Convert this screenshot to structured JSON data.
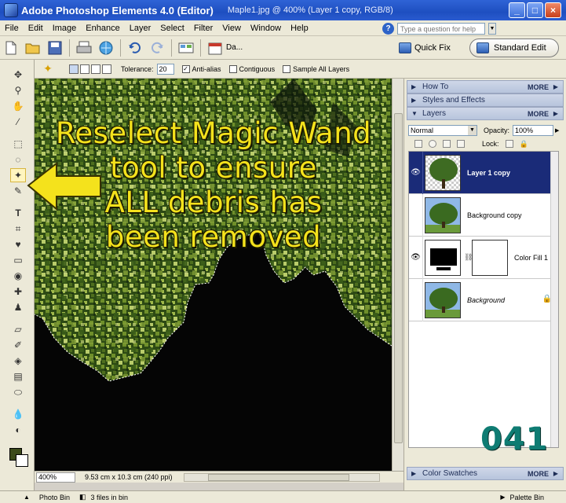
{
  "app": {
    "title": "Adobe Photoshop Elements 4.0 (Editor)",
    "document": "Maple1.jpg @ 400% (Layer 1 copy, RGB/8)"
  },
  "window_buttons": {
    "minimize": "_",
    "maximize": "□",
    "close": "×"
  },
  "menu": [
    "File",
    "Edit",
    "Image",
    "Enhance",
    "Layer",
    "Select",
    "Filter",
    "View",
    "Window",
    "Help"
  ],
  "help": {
    "placeholder": "Type a question for help"
  },
  "toolbar": {
    "icons": [
      "new-icon",
      "open-icon",
      "save-icon",
      "print-icon",
      "online-services-icon",
      "undo-icon",
      "redo-icon",
      "organizer-icon",
      "date-view-icon"
    ],
    "date_view_label": "Da...",
    "quick_fix_label": "Quick Fix",
    "standard_edit_label": "Standard Edit"
  },
  "options": {
    "tolerance_label": "Tolerance:",
    "tolerance_value": "20",
    "anti_alias_label": "Anti-alias",
    "anti_alias_checked": true,
    "contiguous_label": "Contiguous",
    "contiguous_checked": false,
    "sample_all_label": "Sample All Layers",
    "sample_all_checked": false
  },
  "tools": [
    "move-tool",
    "zoom-tool",
    "hand-tool",
    "eyedropper-tool",
    "marquee-tool",
    "lasso-tool",
    "magic-wand-tool",
    "selection-brush-tool",
    "type-tool",
    "crop-tool",
    "cookie-cutter-tool",
    "straighten-tool",
    "red-eye-tool",
    "healing-brush-tool",
    "clone-stamp-tool",
    "eraser-tool",
    "brush-tool",
    "paint-bucket-tool",
    "gradient-tool",
    "shape-tool",
    "blur-tool",
    "sponge-tool"
  ],
  "colors": {
    "foreground": "#3b4a1a",
    "background": "#ffffff",
    "overlay_text": "#f4e21c",
    "frame_number": "#0f7c73",
    "selected_layer": "#1a2b78"
  },
  "overlay": {
    "lines": [
      "Reselect Magic Wand",
      "tool to ensure",
      "ALL debris has",
      "been removed"
    ]
  },
  "status": {
    "zoom": "400%",
    "doc_info": "9.53 cm x 10.3 cm (240 ppi)"
  },
  "palette_bin": {
    "how_to": {
      "label": "How To",
      "more": "MORE"
    },
    "styles": {
      "label": "Styles and Effects"
    },
    "layers": {
      "label": "Layers",
      "more": "MORE",
      "blend_mode": "Normal",
      "opacity_label": "Opacity:",
      "opacity_value": "100%",
      "lock_label": "Lock:",
      "items": [
        {
          "name": "Layer 1 copy",
          "visible": true,
          "selected": true
        },
        {
          "name": "Background copy",
          "visible": false,
          "selected": false
        },
        {
          "name": "Color Fill 1",
          "visible": true,
          "selected": false
        },
        {
          "name": "Background",
          "visible": false,
          "selected": false,
          "locked": true
        }
      ]
    },
    "color_swatches": {
      "label": "Color Swatches",
      "more": "MORE"
    }
  },
  "frame_number": "041",
  "bottom": {
    "photo_bin": "Photo Bin",
    "files_in_bin": "3 files in bin",
    "palette_bin": "Palette Bin"
  }
}
